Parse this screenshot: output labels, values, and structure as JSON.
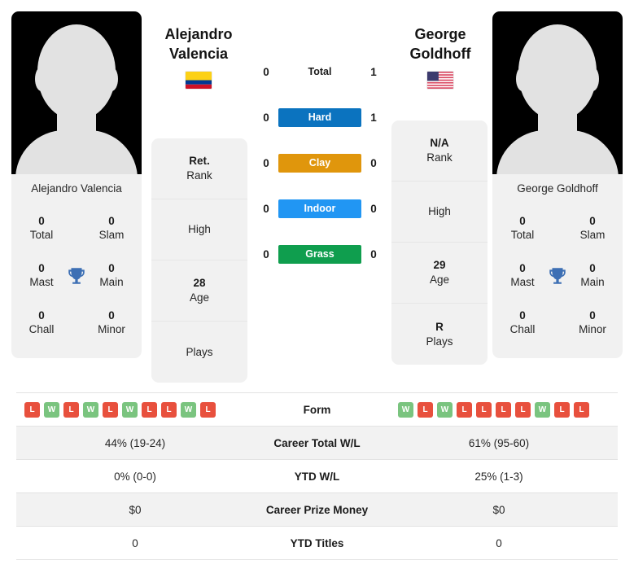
{
  "players": {
    "left": {
      "first_name": "Alejandro",
      "last_name": "Valencia",
      "full_name": "Alejandro Valencia",
      "flag": "colombia-flag",
      "titles": [
        {
          "value": "0",
          "label": "Total"
        },
        {
          "value": "0",
          "label": "Slam"
        },
        {
          "value": "0",
          "label": "Mast"
        },
        {
          "value": "0",
          "label": "Main"
        },
        {
          "value": "0",
          "label": "Chall"
        },
        {
          "value": "0",
          "label": "Minor"
        }
      ],
      "info": [
        {
          "value": "Ret.",
          "label": "Rank"
        },
        {
          "value": "",
          "label": "High"
        },
        {
          "value": "28",
          "label": "Age"
        },
        {
          "value": "",
          "label": "Plays"
        }
      ],
      "form": [
        "L",
        "W",
        "L",
        "W",
        "L",
        "W",
        "L",
        "L",
        "W",
        "L"
      ]
    },
    "right": {
      "first_name": "George",
      "last_name": "Goldhoff",
      "full_name": "George Goldhoff",
      "flag": "usa-flag",
      "titles": [
        {
          "value": "0",
          "label": "Total"
        },
        {
          "value": "0",
          "label": "Slam"
        },
        {
          "value": "0",
          "label": "Mast"
        },
        {
          "value": "0",
          "label": "Main"
        },
        {
          "value": "0",
          "label": "Chall"
        },
        {
          "value": "0",
          "label": "Minor"
        }
      ],
      "info": [
        {
          "value": "N/A",
          "label": "Rank"
        },
        {
          "value": "",
          "label": "High"
        },
        {
          "value": "29",
          "label": "Age"
        },
        {
          "value": "R",
          "label": "Plays"
        }
      ],
      "form": [
        "W",
        "L",
        "W",
        "L",
        "L",
        "L",
        "L",
        "W",
        "L",
        "L"
      ]
    }
  },
  "head_to_head": [
    {
      "label": "Total",
      "left": "0",
      "right": "1",
      "style": "plain",
      "color": ""
    },
    {
      "label": "Hard",
      "left": "0",
      "right": "1",
      "style": "badge",
      "color": "#0b73bf"
    },
    {
      "label": "Clay",
      "left": "0",
      "right": "0",
      "style": "badge",
      "color": "#e0960c"
    },
    {
      "label": "Indoor",
      "left": "0",
      "right": "0",
      "style": "badge",
      "color": "#2196f3"
    },
    {
      "label": "Grass",
      "left": "0",
      "right": "0",
      "style": "badge",
      "color": "#0f9e4e"
    }
  ],
  "comparison_rows": [
    {
      "label": "Form",
      "type": "form",
      "left": "",
      "right": ""
    },
    {
      "label": "Career Total W/L",
      "type": "text",
      "left": "44% (19-24)",
      "right": "61% (95-60)"
    },
    {
      "label": "YTD W/L",
      "type": "text",
      "left": "0% (0-0)",
      "right": "25% (1-3)"
    },
    {
      "label": "Career Prize Money",
      "type": "text",
      "left": "$0",
      "right": "$0"
    },
    {
      "label": "YTD Titles",
      "type": "text",
      "left": "0",
      "right": "0"
    }
  ],
  "colors": {
    "win_badge": "#e8503d",
    "loss_badge": "#7ac47f",
    "trophy": "#3d6fb4",
    "card_bg": "#f1f1f1",
    "row_alt_bg": "#f2f2f2"
  }
}
